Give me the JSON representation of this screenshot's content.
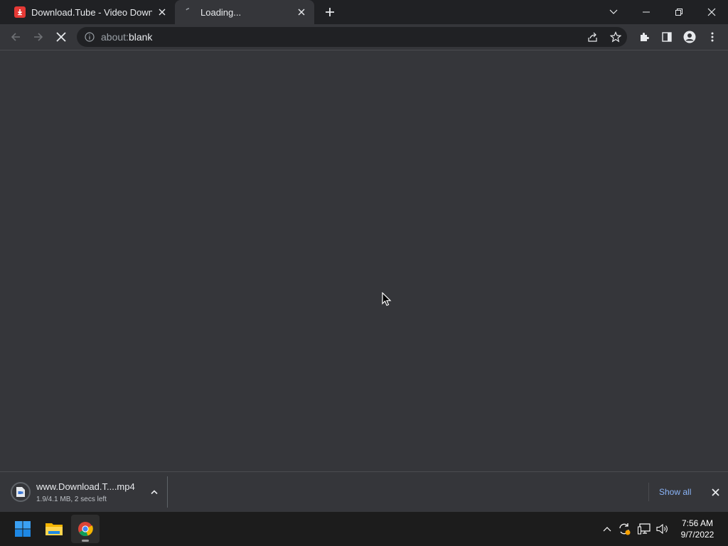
{
  "tabs": [
    {
      "title": "Download.Tube - Video Downloa",
      "favicon": "download-tube-favicon",
      "active": false
    },
    {
      "title": "Loading...",
      "favicon": "loading-spinner-icon",
      "active": true
    }
  ],
  "window_controls": [
    "tab-search-icon",
    "minimize-icon",
    "restore-icon",
    "close-icon"
  ],
  "omnibox": {
    "scheme": "about:",
    "host": "blank"
  },
  "toolbar_icons": [
    "back-icon",
    "forward-icon",
    "stop-loading-icon",
    "share-icon",
    "bookmark-star-icon",
    "extensions-icon",
    "side-panel-icon",
    "profile-icon",
    "menu-icon"
  ],
  "download_shelf": {
    "filename": "www.Download.T....mp4",
    "status": "1.9/4.1 MB, 2 secs left",
    "show_all_label": "Show all"
  },
  "taskbar": {
    "apps": [
      "windows-start-icon",
      "file-explorer-icon",
      "chrome-icon"
    ],
    "tray_icons": [
      "show-hidden-icons-chevron",
      "sync-icon",
      "network-icon",
      "volume-icon"
    ],
    "time": "7:56 AM",
    "date": "9/7/2022"
  },
  "colors": {
    "tab_strip": "#202124",
    "toolbar": "#35363a",
    "accent_link": "#8ab4f8",
    "taskbar": "#1c1c1c"
  }
}
